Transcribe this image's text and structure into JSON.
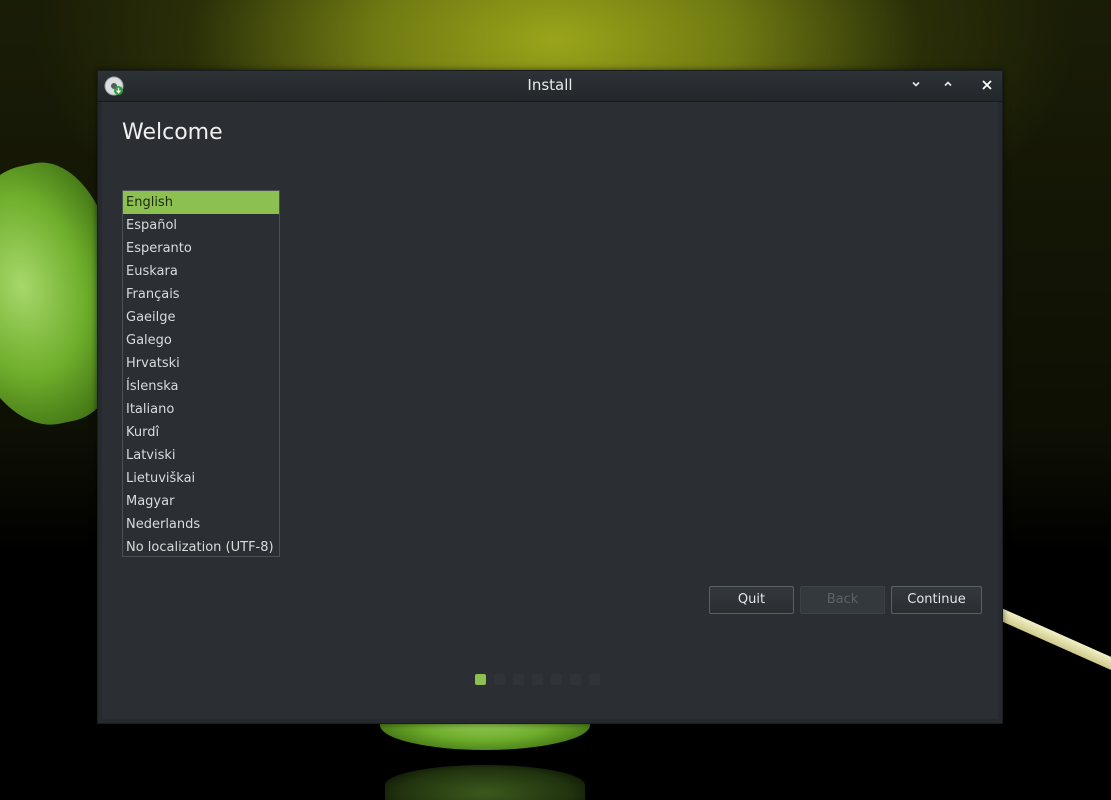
{
  "window": {
    "title": "Install",
    "controls": {
      "minimize_icon": "chevron-down-icon",
      "maximize_icon": "chevron-up-icon",
      "close_icon": "close-icon"
    }
  },
  "page": {
    "title": "Welcome"
  },
  "languages": {
    "selected_index": 0,
    "items": [
      "English",
      "Español",
      "Esperanto",
      "Euskara",
      "Français",
      "Gaeilge",
      "Galego",
      "Hrvatski",
      "Íslenska",
      "Italiano",
      "Kurdî",
      "Latviski",
      "Lietuviškai",
      "Magyar",
      "Nederlands",
      "No localization (UTF-8)"
    ]
  },
  "buttons": {
    "quit": "Quit",
    "back": "Back",
    "continue": "Continue"
  },
  "progress": {
    "current_step": 1,
    "total_steps": 7
  },
  "colors": {
    "accent": "#8cc152",
    "window_bg": "#2b2f33",
    "titlebar_bg": "#262a2e"
  }
}
